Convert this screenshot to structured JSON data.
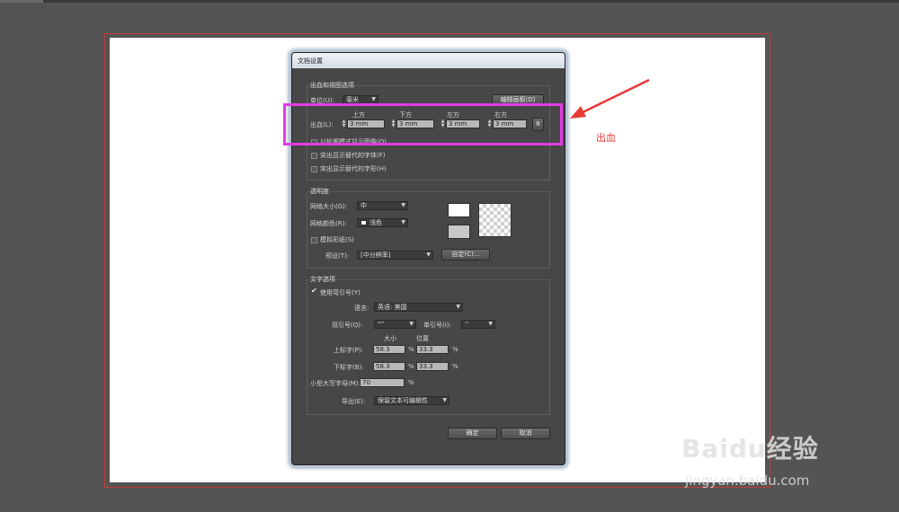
{
  "dialog": {
    "title": "文档设置",
    "bleed_group": {
      "title": "出血和视图选项",
      "units_label": "单位(U):",
      "units_value": "毫米",
      "edit_artboards_button": "编辑画板(D)",
      "top_label": "上方",
      "bottom_label": "下方",
      "left_label": "左方",
      "right_label": "右方",
      "bleed_label": "出血(L):",
      "top_value": "3 mm",
      "bottom_value": "3 mm",
      "left_value": "3 mm",
      "right_value": "3 mm",
      "outline_images": "以轮廓模式显示图像(O)",
      "highlight_fonts": "突出显示替代的字体(F)",
      "highlight_glyphs": "突出显示替代的字形(H)"
    },
    "transparency_group": {
      "title": "透明度",
      "grid_size_label": "网格大小(G):",
      "grid_size_value": "中",
      "grid_colors_label": "网格颜色(R):",
      "grid_colors_value": "浅色",
      "simulate_paper": "模拟彩纸(S)",
      "preset_label": "预设(T):",
      "preset_value": "[中分辨率]",
      "custom_button": "自定(C)..."
    },
    "type_group": {
      "title": "文字选项",
      "use_typo_quotes": "使用弯引号(Y)",
      "use_typo_quotes_checked": true,
      "language_label": "语言:",
      "language_value": "英语: 美国",
      "double_quotes_label": "双引号(Q):",
      "double_quotes_value": "“”",
      "single_quotes_label": "单引号(I):",
      "single_quotes_value": "‘’",
      "size_header": "大小",
      "position_header": "位置",
      "superscript_label": "上标字(P):",
      "superscript_size": "58.3",
      "superscript_position": "33.3",
      "subscript_label": "下标字(B):",
      "subscript_size": "58.3",
      "subscript_position": "33.3",
      "small_caps_label": "小型大写字母(M):",
      "small_caps_value": "70",
      "percent": "%",
      "export_label": "导出(E):",
      "export_value": "保留文本可编辑性"
    },
    "ok_button": "确定",
    "cancel_button": "取消"
  },
  "annotation": {
    "text": "出血",
    "color": "#e53935",
    "box_color": "#e53be6"
  },
  "watermark": {
    "brand": "Baidu经验",
    "url": "jingyan.baidu.com"
  }
}
